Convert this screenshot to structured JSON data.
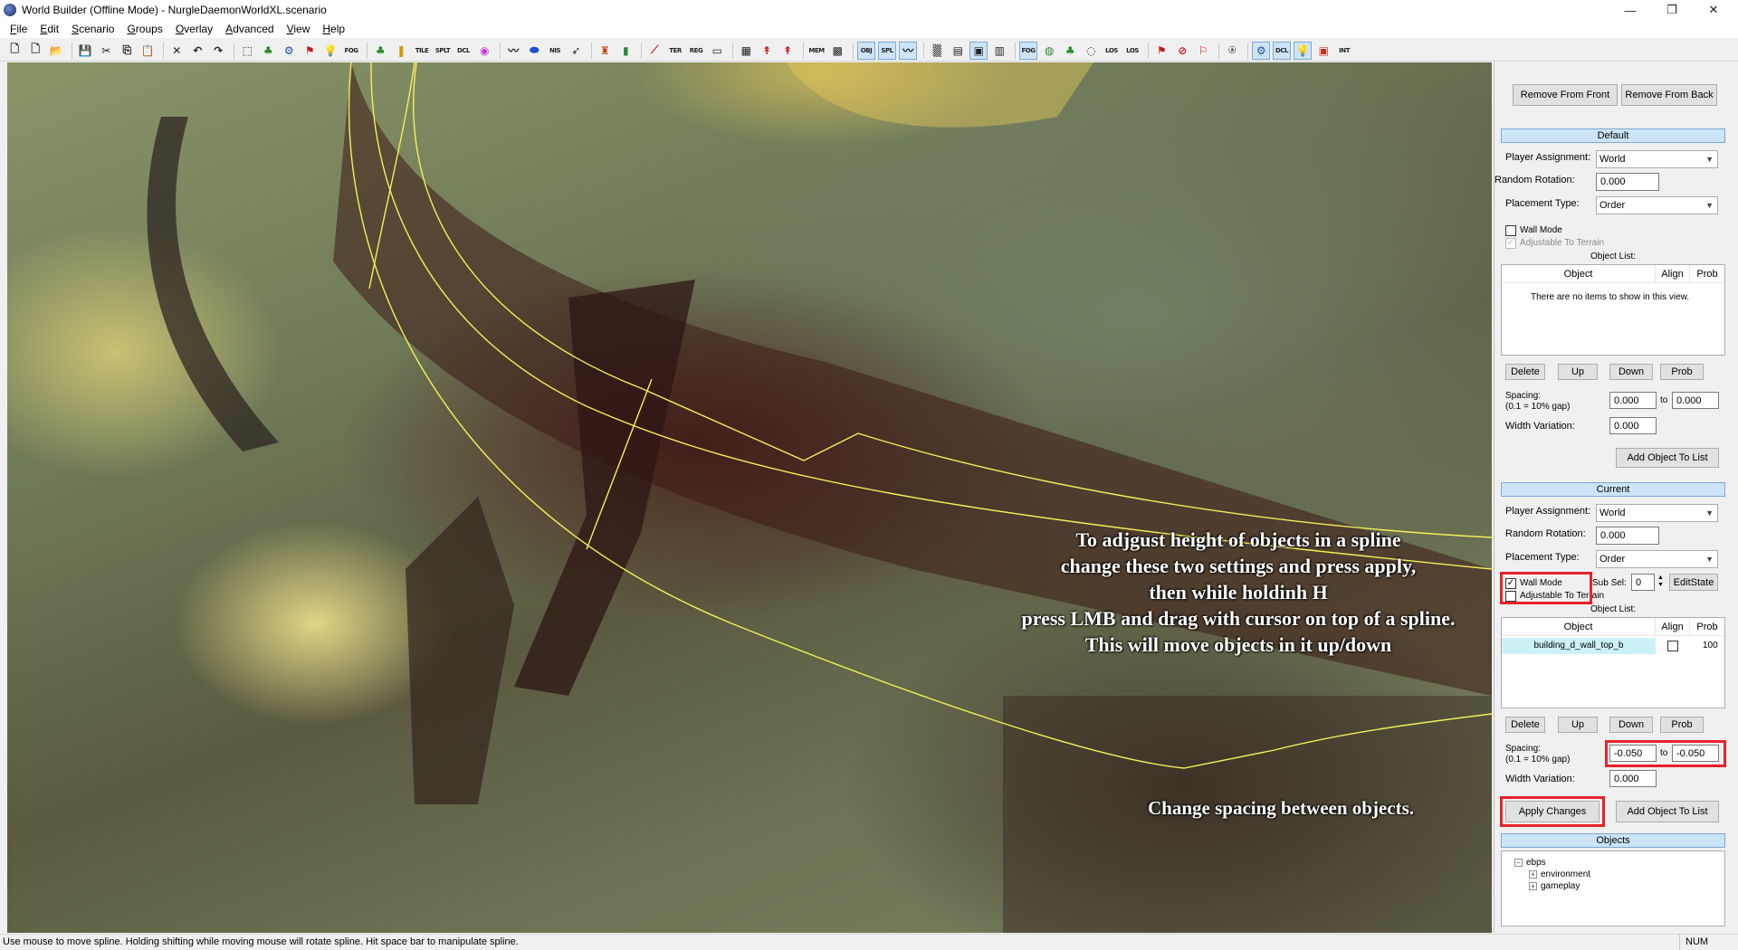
{
  "window": {
    "title": "World Builder (Offline Mode) - NurgleDaemonWorldXL.scenario",
    "controls": {
      "minimize": "—",
      "restore": "❐",
      "close": "✕"
    }
  },
  "menu": [
    "File",
    "Edit",
    "Scenario",
    "Groups",
    "Overlay",
    "Advanced",
    "View",
    "Help"
  ],
  "toolbar": {
    "labels": {
      "fog": "FOG",
      "tile": "TILE",
      "splt": "SPLT",
      "dcl": "DCL",
      "nis": "NIS",
      "ter": "TER",
      "reg": "REG",
      "mem": "MEM",
      "obj": "OBJ",
      "spl": "SPL",
      "fog2": "FOG",
      "dcl2": "DCL",
      "los1": "LOS",
      "los2": "LOS",
      "int": "INT"
    }
  },
  "annotations": {
    "main": [
      "To adjgust height of objects in a spline",
      "change these two settings and press apply,",
      "then while holdinh H",
      "press LMB and drag with cursor on top of a spline.",
      "This will move objects in it up/down"
    ],
    "spacing": "Change spacing between objects."
  },
  "panel": {
    "remove_front": "Remove From Front",
    "remove_back": "Remove From Back",
    "default": {
      "header": "Default",
      "player_assignment_label": "Player Assignment:",
      "player_assignment": "World",
      "random_rotation_label": "Random Rotation:",
      "random_rotation": "0.000",
      "placement_type_label": "Placement Type:",
      "placement_type": "Order",
      "wall_mode": "Wall Mode",
      "adjustable_terrain": "Adjustable To Terrain",
      "object_list_label": "Object List:",
      "columns": [
        "Object",
        "Align",
        "Prob"
      ],
      "empty_text": "There are no items to show in this view.",
      "buttons": [
        "Delete",
        "Up",
        "Down",
        "Prob"
      ],
      "spacing_label": "Spacing:",
      "spacing_hint": "(0.1 = 10% gap)",
      "spacing_from": "0.000",
      "to_label": "to",
      "spacing_to": "0.000",
      "width_variation_label": "Width Variation:",
      "width_variation": "0.000",
      "add_object": "Add Object To List"
    },
    "current": {
      "header": "Current",
      "player_assignment_label": "Player Assignment:",
      "player_assignment": "World",
      "random_rotation_label": "Random Rotation:",
      "random_rotation": "0.000",
      "placement_type_label": "Placement Type:",
      "placement_type": "Order",
      "wall_mode": "Wall Mode",
      "adjustable_terrain": "Adjustable To Terrain",
      "sub_sel_label": "Sub Sel:",
      "sub_sel_value": "0",
      "edit_state": "EditState",
      "object_list_label": "Object List:",
      "columns": [
        "Object",
        "Align",
        "Prob"
      ],
      "rows": [
        {
          "object": "building_d_wall_top_b",
          "prob": "100"
        }
      ],
      "buttons": [
        "Delete",
        "Up",
        "Down",
        "Prob"
      ],
      "spacing_label": "Spacing:",
      "spacing_hint": "(0.1 = 10% gap)",
      "spacing_from": "-0.050",
      "to_label": "to",
      "spacing_to": "-0.050",
      "width_variation_label": "Width Variation:",
      "width_variation": "0.000",
      "apply": "Apply Changes",
      "add_object": "Add Object To List"
    },
    "objects": {
      "header": "Objects",
      "tree": [
        {
          "label": "ebps",
          "toggle": "−"
        },
        {
          "label": "environment",
          "toggle": "+"
        },
        {
          "label": "gameplay",
          "toggle": "+"
        }
      ]
    }
  },
  "statusbar": {
    "message": "Use mouse to move spline. Holding shifting while moving mouse will rotate spline. Hit space bar to manipulate spline.",
    "num": "NUM"
  },
  "colors": {
    "highlight_red": "#e8222a",
    "spline_yellow": "#f2f05a",
    "section_blue": "#cce4f7",
    "selected_row": "#ccf2f7"
  }
}
